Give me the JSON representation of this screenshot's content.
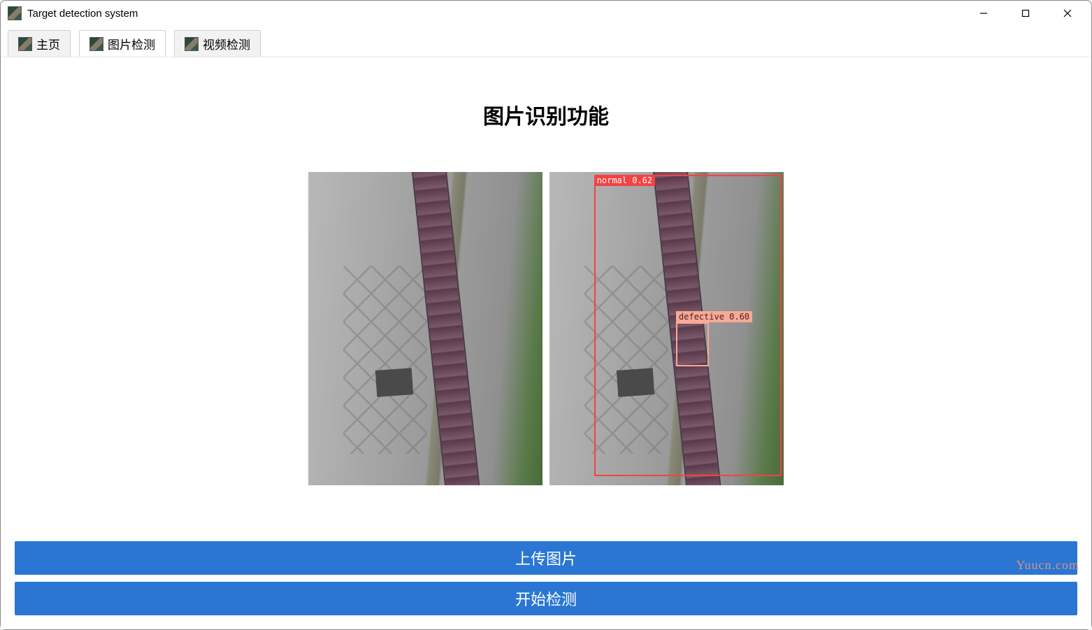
{
  "window": {
    "title": "Target detection system"
  },
  "tabs": {
    "home": "主页",
    "image": "图片检测",
    "video": "视频检测"
  },
  "main": {
    "heading": "图片识别功能"
  },
  "detections": {
    "normal_label": "normal 0.62",
    "defective_label": "defective 0.60"
  },
  "buttons": {
    "upload": "上传图片",
    "detect": "开始检测"
  },
  "watermark": "Yuucn.com"
}
